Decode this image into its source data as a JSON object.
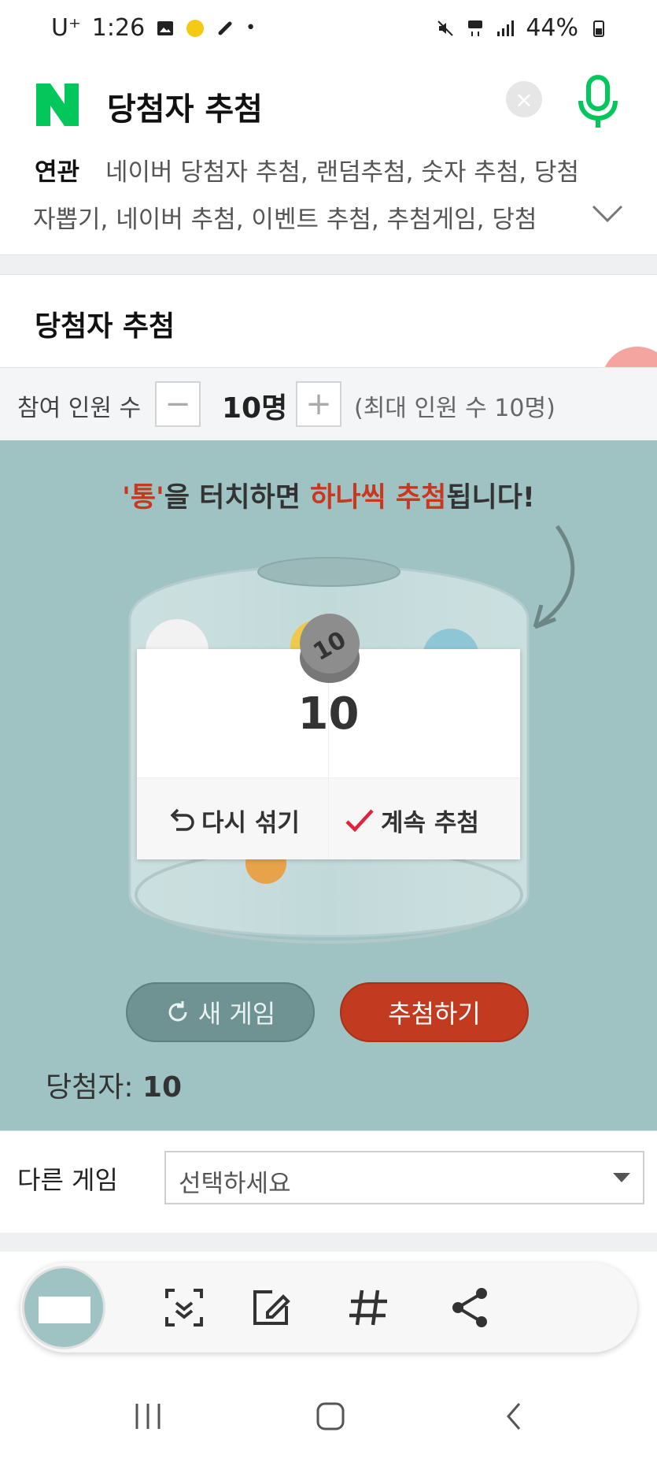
{
  "status_bar": {
    "carrier": "U⁺",
    "time": "1:26",
    "battery": "44%"
  },
  "search": {
    "query": "당첨자 추첨",
    "clear_label": "×"
  },
  "related": {
    "label": "연관",
    "line1": "네이버 당첨자 추첨, 랜덤추첨, 숫자 추첨, 당첨",
    "line2": "자뽑기, 네이버 추첨, 이벤트 추첨, 추첨게임, 당첨"
  },
  "panel": {
    "title": "당첨자 추첨",
    "participants_label": "참여 인원 수",
    "minus_label": "−",
    "plus_label": "+",
    "count": "10명",
    "max_note": "(최대 인원 수 10명)"
  },
  "stage": {
    "instruction_part1": "'통'",
    "instruction_part2": "을 터치하면 ",
    "instruction_part3": "하나씩 추첨",
    "instruction_part4": "됩니다!",
    "ball_number": "10",
    "result_number": "10",
    "reshuffle_label": "다시 섞기",
    "continue_label": "계속 추첨",
    "new_game_label": "새 게임",
    "draw_label": "추첨하기",
    "winners_label": "당첨자:",
    "winners_value": "10"
  },
  "other_game": {
    "label": "다른 게임",
    "select_value": "선택하세요"
  },
  "colors": {
    "naver_green": "#03c75a",
    "stage_teal": "#9fc3c3",
    "draw_red": "#c23a1f",
    "highlight_red": "#c9371f"
  },
  "toolbar_icons": [
    "scroll-capture-icon",
    "edit-icon",
    "tag-icon",
    "share-icon"
  ],
  "nav_icons": [
    "recent-apps-icon",
    "home-icon",
    "back-icon"
  ]
}
